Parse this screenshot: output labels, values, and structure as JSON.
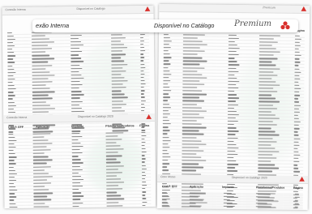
{
  "banner": {
    "left_text": "exão Interna",
    "center_text": "Disponível no Catálogo",
    "signature": "Premium"
  },
  "left_page": {
    "header_title": "Conexão Interna",
    "header_center": "Disponível no Catálogo",
    "columns": [
      "Cód.P. EFF",
      "Aplicação",
      "Implante",
      "Plataforma/Produtos",
      "Página"
    ],
    "sub_header_title": "Conexão Interna",
    "sub_header_center": "Disponível no Catálogo 2020",
    "sub_columns": [
      "Cód.P. EFF",
      "Aplicação",
      "Implante",
      "Plataforma/Produtos",
      "Página"
    ]
  },
  "right_page": {
    "header_right": "Premium",
    "columns_hint": [
      "Aplic",
      "Página"
    ],
    "footer_title": "Cone Morse",
    "footer_center": "Disponível no Catálogo 2020",
    "footer_columns": [
      "Cód.P. EFF",
      "Aplicação",
      "Implante",
      "Plataforma/Produtos",
      "Página"
    ]
  },
  "colors": {
    "accent": "#d8302c",
    "swirl": "#cfe7d8"
  }
}
